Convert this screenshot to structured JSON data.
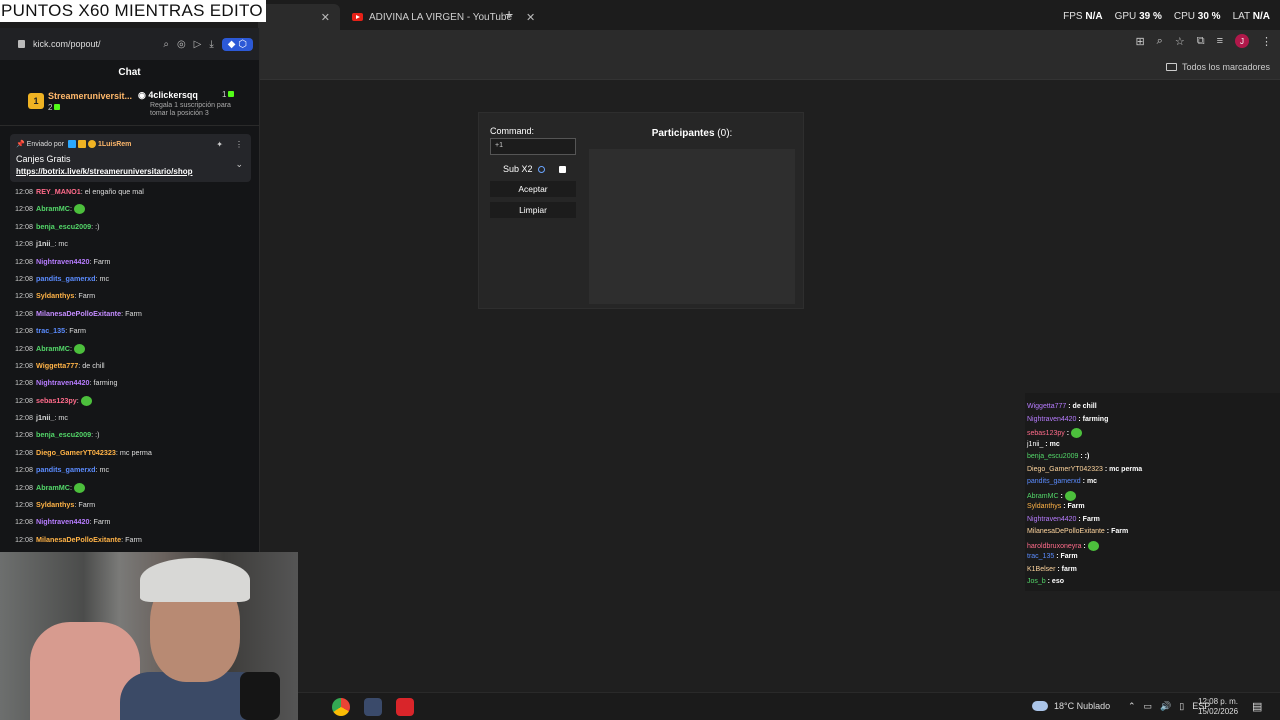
{
  "stream": {
    "title": "PUNTOS X60 MIENTRAS EDITO"
  },
  "browser": {
    "tabs": [
      {
        "label": "",
        "active": true
      },
      {
        "label": "ADIVINA LA VIRGEN - YouTube",
        "active": false
      }
    ],
    "close_glyph": "✕",
    "new_tab": "+",
    "bookmarks_label": "Todos los marcadores",
    "profile_initial": "J"
  },
  "hud": {
    "fps_label": "FPS",
    "fps": "N/A",
    "gpu_label": "GPU",
    "gpu": "39 %",
    "cpu_label": "CPU",
    "cpu": "30 %",
    "lat_label": "LAT",
    "lat": "N/A"
  },
  "popout": {
    "url": "kick.com/popout/",
    "chat_title": "Chat",
    "leaderboard": [
      {
        "rank": "1",
        "name": "Streameruniversit...",
        "count": "2"
      },
      {
        "name": "4clickersqq",
        "count": "1",
        "note": "Regala 1 suscripción para tomar la posición 3"
      }
    ],
    "pinned": {
      "by_prefix": "Enviado por",
      "by_user": "1LuisRem",
      "title": "Canjes Gratis",
      "link": "https://botrix.live/k/streameruniversitario/shop"
    },
    "messages": [
      {
        "time": "12:08",
        "user": "REY_MANO1",
        "color": "#ff6b8a",
        "text": "el engaño que mal"
      },
      {
        "time": "12:08",
        "user": "AbramMC",
        "color": "#53d769",
        "text": "",
        "emote": true
      },
      {
        "time": "12:08",
        "user": "benja_escu2009",
        "color": "#53d769",
        "text": ":)"
      },
      {
        "time": "12:08",
        "user": "j1nii_",
        "color": "#dddddd",
        "text": "mc"
      },
      {
        "time": "12:08",
        "user": "Nightraven4420",
        "color": "#b77cff",
        "text": "Farm"
      },
      {
        "time": "12:08",
        "user": "pandits_gamerxd",
        "color": "#5b8cff",
        "text": "mc"
      },
      {
        "time": "12:08",
        "user": "Syldanthys",
        "color": "#ffb347",
        "text": "Farm"
      },
      {
        "time": "12:08",
        "user": "MilanesaDePolloExitante",
        "color": "#c48cff",
        "text": "Farm"
      },
      {
        "time": "12:08",
        "user": "trac_135",
        "color": "#5b8cff",
        "text": "Farm"
      },
      {
        "time": "12:08",
        "user": "AbramMC",
        "color": "#53d769",
        "text": "",
        "emote": true
      },
      {
        "time": "12:08",
        "user": "Wiggetta777",
        "color": "#ffb347",
        "text": "de chill"
      },
      {
        "time": "12:08",
        "user": "Nightraven4420",
        "color": "#b77cff",
        "text": "farming"
      },
      {
        "time": "12:08",
        "user": "sebas123py",
        "color": "#ff6b8a",
        "text": "",
        "emote": true
      },
      {
        "time": "12:08",
        "user": "j1nii_",
        "color": "#dddddd",
        "text": "mc"
      },
      {
        "time": "12:08",
        "user": "benja_escu2009",
        "color": "#53d769",
        "text": ":)"
      },
      {
        "time": "12:08",
        "user": "Diego_GamerYT042323",
        "color": "#ffb347",
        "text": "mc perma"
      },
      {
        "time": "12:08",
        "user": "pandits_gamerxd",
        "color": "#5b8cff",
        "text": "mc"
      },
      {
        "time": "12:08",
        "user": "AbramMC",
        "color": "#53d769",
        "text": "",
        "emote": true
      },
      {
        "time": "12:08",
        "user": "Syldanthys",
        "color": "#ffb347",
        "text": "Farm"
      },
      {
        "time": "12:08",
        "user": "Nightraven4420",
        "color": "#b77cff",
        "text": "Farm"
      },
      {
        "time": "12:08",
        "user": "MilanesaDePolloExitante",
        "color": "#ffb347",
        "text": "Farm"
      }
    ]
  },
  "app": {
    "command_label": "Command:",
    "command_value": "+1",
    "sub_label": "Sub X2",
    "accept_label": "Aceptar",
    "clear_label": "Limpiar",
    "participants_label": "Participantes",
    "participants_count": "(0):"
  },
  "overlay_chat": [
    {
      "user": "Wiggetta777",
      "color": "#b77cff",
      "text": "de chill"
    },
    {
      "user": "Nightraven4420",
      "color": "#b77cff",
      "text": "farming"
    },
    {
      "user": "sebas123py",
      "color": "#ff6b8a",
      "text": "",
      "emote": true
    },
    {
      "user": "j1nii_",
      "color": "#ffffff",
      "text": "mc"
    },
    {
      "user": "benja_escu2009",
      "color": "#53d769",
      "text": ":)"
    },
    {
      "user": "Diego_GamerYT042323",
      "color": "#ffd59e",
      "text": "mc perma"
    },
    {
      "user": "pandits_gamerxd",
      "color": "#5b8cff",
      "text": "mc"
    },
    {
      "user": "AbramMC",
      "color": "#53d769",
      "text": "",
      "emote": true
    },
    {
      "user": "Syldanthys",
      "color": "#ffb347",
      "text": "Farm"
    },
    {
      "user": "Nightraven4420",
      "color": "#b77cff",
      "text": "Farm"
    },
    {
      "user": "MilanesaDePolloExitante",
      "color": "#ffd59e",
      "text": "Farm"
    },
    {
      "user": "haroldbruxoneyra",
      "color": "#ff6b8a",
      "text": "",
      "emote": true
    },
    {
      "user": "trac_135",
      "color": "#5b8cff",
      "text": "Farm"
    },
    {
      "user": "K1Belser",
      "color": "#ffd59e",
      "text": "farm"
    },
    {
      "user": "Jos_b",
      "color": "#53d769",
      "text": "eso"
    }
  ],
  "taskbar": {
    "weather": "18°C Nublado",
    "language": "ESP",
    "time": "12:08 p. m.",
    "date": "15/02/2026"
  }
}
